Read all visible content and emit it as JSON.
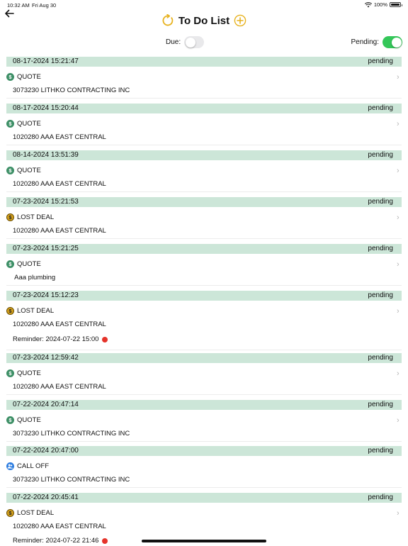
{
  "status_bar": {
    "time": "10:32 AM",
    "date": "Fri Aug 30",
    "battery": "100%"
  },
  "header": {
    "title": "To Do List",
    "icons": {
      "back": "back-arrow-icon",
      "refresh": "refresh-icon",
      "add": "add-icon"
    }
  },
  "filters": {
    "due_label": "Due:",
    "due_on": false,
    "pending_label": "Pending:",
    "pending_on": true
  },
  "items": [
    {
      "date": "08-17-2024 15:21:47",
      "status": "pending",
      "type": "QUOTE",
      "icon": "dollar-icon",
      "customer": "3073230 LITHKO CONTRACTING INC",
      "reminder": ""
    },
    {
      "date": "08-17-2024 15:20:44",
      "status": "pending",
      "type": "QUOTE",
      "icon": "dollar-icon",
      "customer": "1020280 AAA EAST CENTRAL",
      "reminder": ""
    },
    {
      "date": "08-14-2024 13:51:39",
      "status": "pending",
      "type": "QUOTE",
      "icon": "dollar-icon",
      "customer": "1020280 AAA EAST CENTRAL",
      "reminder": ""
    },
    {
      "date": "07-23-2024 15:21:53",
      "status": "pending",
      "type": "LOST DEAL",
      "icon": "dollar-icon",
      "customer": "1020280 AAA EAST CENTRAL",
      "reminder": ""
    },
    {
      "date": "07-23-2024 15:21:25",
      "status": "pending",
      "type": "QUOTE",
      "icon": "dollar-icon",
      "customer": " Aaa plumbing",
      "reminder": ""
    },
    {
      "date": "07-23-2024 15:12:23",
      "status": "pending",
      "type": "LOST DEAL",
      "icon": "dollar-icon",
      "customer": "1020280 AAA EAST CENTRAL",
      "reminder": "Reminder: 2024-07-22 15:00"
    },
    {
      "date": "07-23-2024 12:59:42",
      "status": "pending",
      "type": "QUOTE",
      "icon": "dollar-icon",
      "customer": "1020280 AAA EAST CENTRAL",
      "reminder": ""
    },
    {
      "date": "07-22-2024 20:47:14",
      "status": "pending",
      "type": "QUOTE",
      "icon": "dollar-icon",
      "customer": "3073230 LITHKO CONTRACTING INC",
      "reminder": ""
    },
    {
      "date": "07-22-2024 20:47:00",
      "status": "pending",
      "type": "CALL OFF",
      "icon": "people-icon",
      "customer": "3073230 LITHKO CONTRACTING INC",
      "reminder": ""
    },
    {
      "date": "07-22-2024 20:45:41",
      "status": "pending",
      "type": "LOST DEAL",
      "icon": "dollar-icon",
      "customer": "1020280 AAA EAST CENTRAL",
      "reminder": "Reminder: 2024-07-22 21:46"
    }
  ],
  "colors": {
    "accent": "#e7b21f",
    "header_bg": "#cce6d8",
    "toggle_on": "#34c759",
    "reminder_dot": "#e5332a"
  }
}
